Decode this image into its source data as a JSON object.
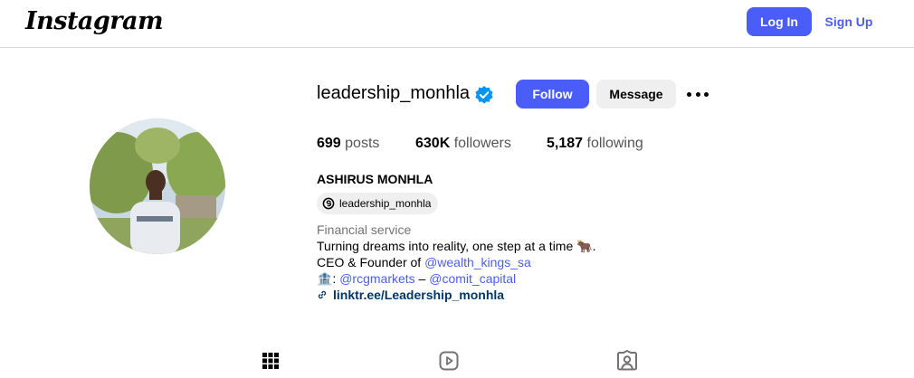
{
  "header": {
    "logo_text": "Instagram",
    "login_label": "Log In",
    "signup_label": "Sign Up"
  },
  "profile": {
    "username": "leadership_monhla",
    "verified": true,
    "follow_label": "Follow",
    "message_label": "Message",
    "stats": {
      "posts_count": "699",
      "posts_label": "posts",
      "followers_count": "630K",
      "followers_label": "followers",
      "following_count": "5,187",
      "following_label": "following"
    },
    "full_name": "ASHIRUS MONHLA",
    "threads_handle": "leadership_monhla",
    "category": "Financial service",
    "bio": {
      "line1": "Turning dreams into reality, one step at a time 🐂.",
      "line2_prefix": "CEO & Founder of ",
      "line2_mention": "@wealth_kings_sa",
      "line3_prefix": "🏦: ",
      "line3_mention1": "@rcgmarkets",
      "line3_sep": " – ",
      "line3_mention2": "@comit_capital",
      "link": "linktr.ee/Leadership_monhla"
    }
  },
  "tabs": [
    {
      "icon": "grid-icon"
    },
    {
      "icon": "reels-icon"
    },
    {
      "icon": "tagged-icon"
    }
  ],
  "colors": {
    "accent": "#4a5df9",
    "verified": "#0095f6",
    "link": "#00376b"
  }
}
